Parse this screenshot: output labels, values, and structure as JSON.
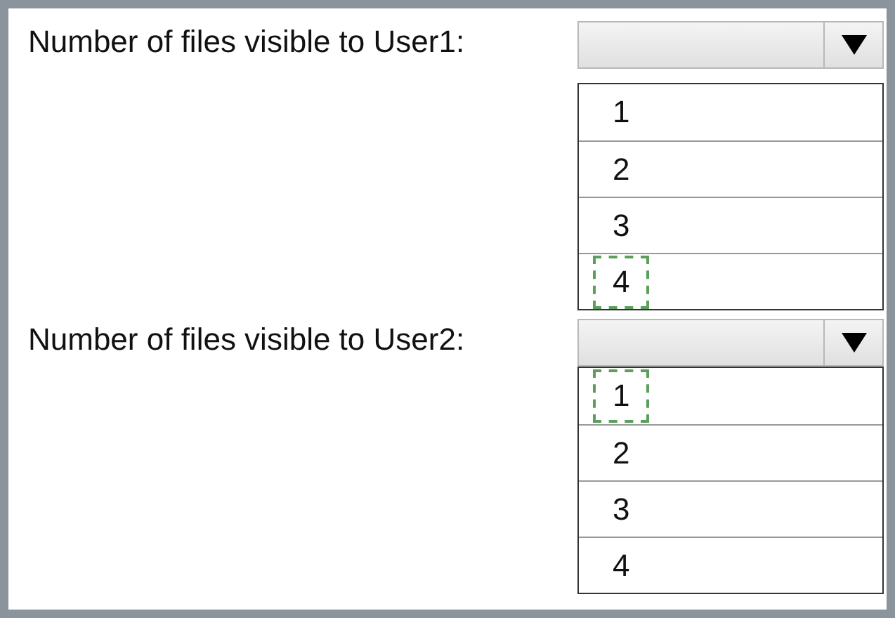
{
  "questions": [
    {
      "label": "Number of files visible to User1:",
      "options": [
        {
          "text": "1",
          "selected": false
        },
        {
          "text": "2",
          "selected": false
        },
        {
          "text": "3",
          "selected": false
        },
        {
          "text": "4",
          "selected": true
        }
      ]
    },
    {
      "label": "Number of files visible to User2:",
      "options": [
        {
          "text": "1",
          "selected": true
        },
        {
          "text": "2",
          "selected": false
        },
        {
          "text": "3",
          "selected": false
        },
        {
          "text": "4",
          "selected": false
        }
      ]
    }
  ]
}
